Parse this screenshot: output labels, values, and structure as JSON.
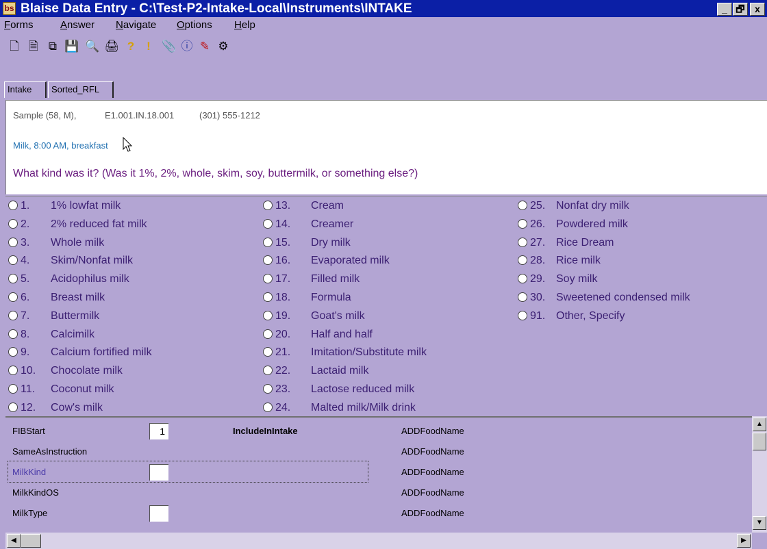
{
  "window": {
    "title": "Blaise Data Entry - C:\\Test-P2-Intake-Local\\Instruments\\INTAKE",
    "app_icon": "bs",
    "minimize": "_",
    "restore": "🗗",
    "close": "x"
  },
  "menu": [
    "Forms",
    "Answer",
    "Navigate",
    "Options",
    "Help"
  ],
  "toolbar_icons": [
    "new-form-icon",
    "open-icon",
    "copy-icon",
    "save-icon",
    "find-icon",
    "print-icon",
    "help-icon",
    "alert-icon",
    "attach-icon",
    "info-icon",
    "pencil-icon",
    "network-icon"
  ],
  "tabs": [
    "Intake",
    "Sorted_RFL"
  ],
  "question": {
    "respondent": "Sample (58, M),",
    "case_id": "E1.001.IN.18.001",
    "phone": "(301) 555-1212",
    "context": "Milk, 8:00 AM, breakfast",
    "text": "What kind was it? (Was it 1%, 2%, whole, skim, soy, buttermilk, or something else?)"
  },
  "options": [
    {
      "code": "1.",
      "label": "1% lowfat milk"
    },
    {
      "code": "2.",
      "label": "2% reduced fat milk"
    },
    {
      "code": "3.",
      "label": "Whole milk"
    },
    {
      "code": "4.",
      "label": "Skim/Nonfat milk"
    },
    {
      "code": "5.",
      "label": "Acidophilus milk"
    },
    {
      "code": "6.",
      "label": "Breast milk"
    },
    {
      "code": "7.",
      "label": "Buttermilk"
    },
    {
      "code": "8.",
      "label": "Calcimilk"
    },
    {
      "code": "9.",
      "label": "Calcium fortified milk"
    },
    {
      "code": "10.",
      "label": "Chocolate milk"
    },
    {
      "code": "11.",
      "label": "Coconut milk"
    },
    {
      "code": "12.",
      "label": "Cow's milk"
    },
    {
      "code": "13.",
      "label": "Cream"
    },
    {
      "code": "14.",
      "label": "Creamer"
    },
    {
      "code": "15.",
      "label": "Dry milk"
    },
    {
      "code": "16.",
      "label": "Evaporated milk"
    },
    {
      "code": "17.",
      "label": "Filled milk"
    },
    {
      "code": "18.",
      "label": "Formula"
    },
    {
      "code": "19.",
      "label": "Goat's milk"
    },
    {
      "code": "20.",
      "label": "Half and half"
    },
    {
      "code": "21.",
      "label": "Imitation/Substitute milk"
    },
    {
      "code": "22.",
      "label": "Lactaid milk"
    },
    {
      "code": "23.",
      "label": "Lactose reduced milk"
    },
    {
      "code": "24.",
      "label": "Malted milk/Milk drink"
    },
    {
      "code": "25.",
      "label": "Nonfat dry milk"
    },
    {
      "code": "26.",
      "label": "Powdered milk"
    },
    {
      "code": "27.",
      "label": "Rice Dream"
    },
    {
      "code": "28.",
      "label": "Rice milk"
    },
    {
      "code": "29.",
      "label": "Soy milk"
    },
    {
      "code": "30.",
      "label": "Sweetened condensed milk"
    },
    {
      "code": "91.",
      "label": "Other, Specify"
    }
  ],
  "fields": [
    {
      "name": "FIBStart",
      "value": "1",
      "has_box": true,
      "group": "IncludeInIntake",
      "type": "ADDFoodName"
    },
    {
      "name": "SameAsInstruction",
      "value": "",
      "has_box": false,
      "group": "",
      "type": "ADDFoodName"
    },
    {
      "name": "MilkKind",
      "value": "",
      "has_box": true,
      "group": "",
      "type": "ADDFoodName",
      "active": true
    },
    {
      "name": "MilkKindOS",
      "value": "",
      "has_box": false,
      "group": "",
      "type": "ADDFoodName"
    },
    {
      "name": "MilkType",
      "value": "",
      "has_box": true,
      "group": "",
      "type": "ADDFoodName"
    }
  ],
  "colors": {
    "title_bar": "#0b1fa6",
    "background": "#b3a5d3",
    "option_text": "#3b1f72",
    "context_text": "#1f6fb0",
    "question_text": "#6b1f80"
  }
}
